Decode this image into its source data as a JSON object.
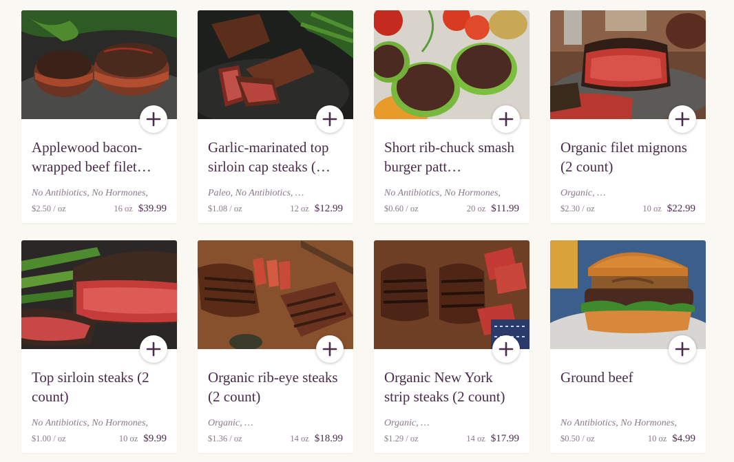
{
  "products": [
    {
      "title": "Applewood bacon-wrapped beef filet…",
      "tags": "No Antibiotics,  No Hormones,",
      "unit_price": "$2.50 / oz",
      "weight": "16 oz",
      "price": "$39.99",
      "image": "bacon-wrapped-filet-photo"
    },
    {
      "title": "Garlic-marinated top sirloin cap steaks (…",
      "tags": "Paleo,  No Antibiotics, …",
      "unit_price": "$1.08 / oz",
      "weight": "12 oz",
      "price": "$12.99",
      "image": "sirloin-cap-steak-photo"
    },
    {
      "title": "Short rib-chuck smash burger patt…",
      "tags": "No Antibiotics,  No Hormones,",
      "unit_price": "$0.60 / oz",
      "weight": "20 oz",
      "price": "$11.99",
      "image": "burger-patties-photo"
    },
    {
      "title": "Organic filet mignons (2 count)",
      "tags": "Organic, …",
      "unit_price": "$2.30 / oz",
      "weight": "10 oz",
      "price": "$22.99",
      "image": "filet-mignon-photo"
    },
    {
      "title": "Top sirloin steaks (2 count)",
      "tags": "No Antibiotics,  No Hormones,",
      "unit_price": "$1.00 / oz",
      "weight": "10 oz",
      "price": "$9.99",
      "image": "top-sirloin-steak-photo"
    },
    {
      "title": "Organic rib-eye steaks (2 count)",
      "tags": "Organic, …",
      "unit_price": "$1.36 / oz",
      "weight": "14 oz",
      "price": "$18.99",
      "image": "rib-eye-steak-photo"
    },
    {
      "title": "Organic New York strip steaks (2 count)",
      "tags": "Organic, …",
      "unit_price": "$1.29 / oz",
      "weight": "14 oz",
      "price": "$17.99",
      "image": "ny-strip-steak-photo"
    },
    {
      "title": "Ground beef",
      "tags": "No Antibiotics,  No Hormones,",
      "unit_price": "$0.50 / oz",
      "weight": "10 oz",
      "price": "$4.99",
      "image": "ground-beef-burger-photo"
    }
  ],
  "add_icon": "plus-icon",
  "colors": {
    "text": "#4a2b4a",
    "muted": "#8a7a8a",
    "page_bg": "#faf8f2"
  }
}
